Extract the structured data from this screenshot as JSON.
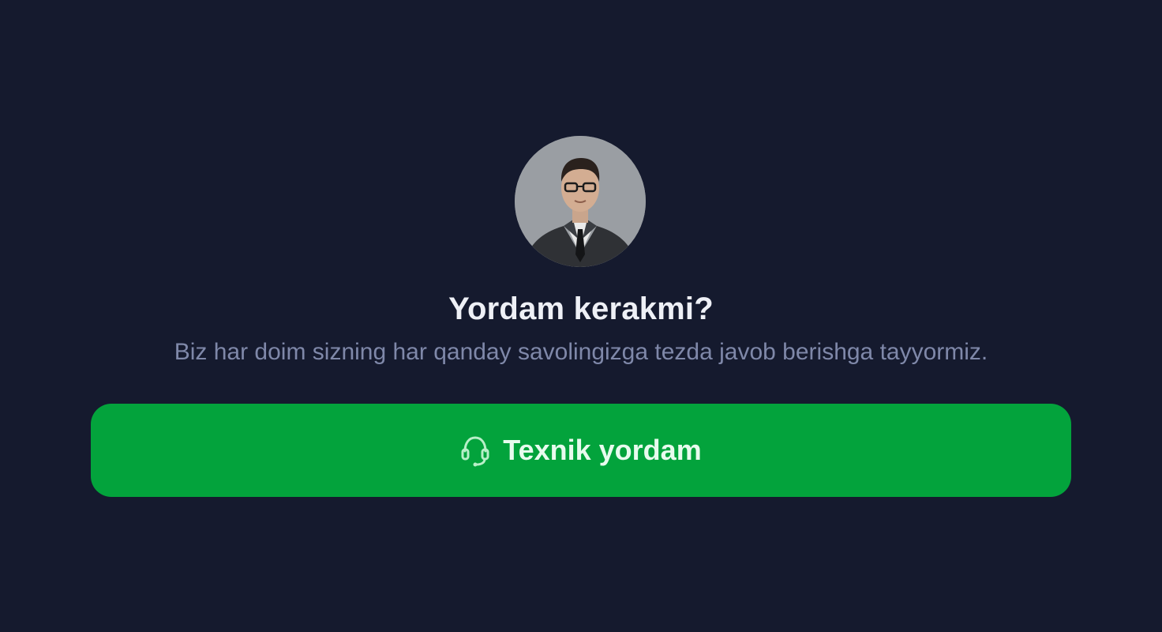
{
  "help": {
    "title": "Yordam kerakmi?",
    "subtitle": "Biz har doim sizning har qanday savolingizga tezda javob berishga tayyormiz.",
    "button_label": "Texnik yordam",
    "button_icon": "headset-icon",
    "avatar_alt": "support-agent-photo"
  },
  "colors": {
    "background": "#151a2e",
    "accent": "#03a33c",
    "title": "#eef0f6",
    "subtitle": "#7f88a9"
  }
}
